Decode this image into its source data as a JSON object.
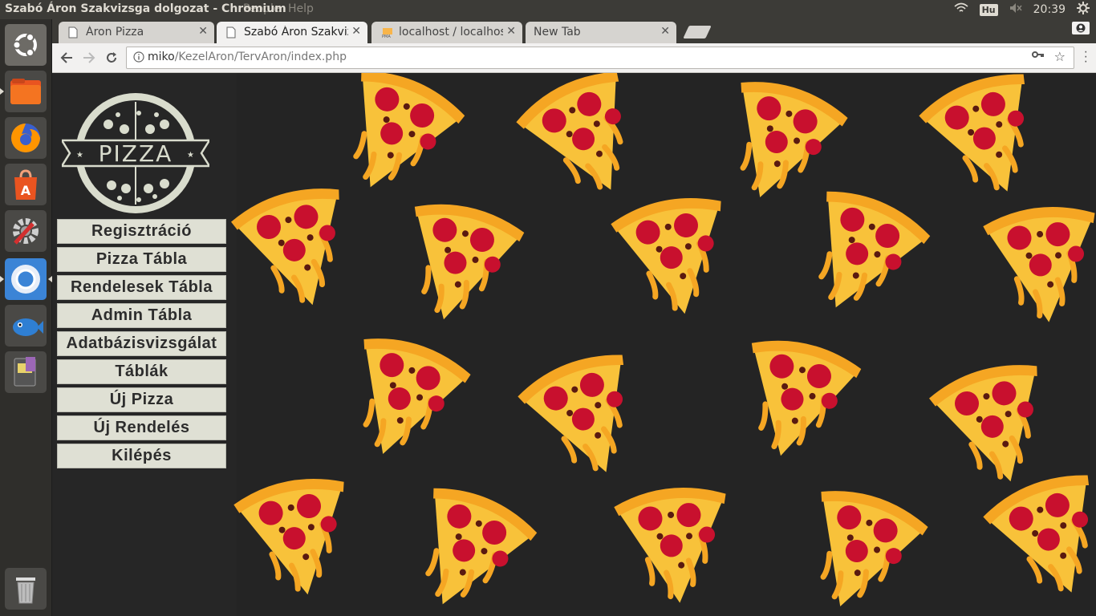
{
  "os": {
    "window_title": "Szabó Áron Szakvizsga dolgozat - Chromium",
    "ghost_menu_1": "People",
    "ghost_menu_2": "Help",
    "keyboard_layout": "Hu",
    "clock": "20:39"
  },
  "launcher": {
    "items": [
      "ubuntu-logo",
      "files",
      "firefox",
      "software-center",
      "system-settings",
      "chromium",
      "vlc",
      "device-manager"
    ],
    "trash": "trash"
  },
  "browser": {
    "tabs": [
      {
        "label": "Áron Pizza",
        "active": false,
        "icon": "page-icon"
      },
      {
        "label": "Szabó Áron Szakviz",
        "active": true,
        "icon": "page-icon"
      },
      {
        "label": "localhost / localhos",
        "active": false,
        "icon": "phpmyadmin-icon"
      },
      {
        "label": "New Tab",
        "active": false,
        "icon": "none"
      }
    ],
    "address": {
      "host": "miko",
      "path": "/KezelAron/TervAron/index.php"
    }
  },
  "site": {
    "logo_text": "PIZZA",
    "menu": [
      "Regisztráció",
      "Pizza Tábla",
      "Rendelesek Tábla",
      "Admin Tábla",
      "Adatbázisvizsgálat",
      "Táblák",
      "Új Pizza",
      "Új Rendelés",
      "Kilépés"
    ],
    "colors": {
      "menu_bg": "#dfe0d4",
      "page_bg": "#242424",
      "crust": "#f5a623",
      "cheese": "#f8c23a",
      "pepperoni": "#c8102e"
    }
  }
}
